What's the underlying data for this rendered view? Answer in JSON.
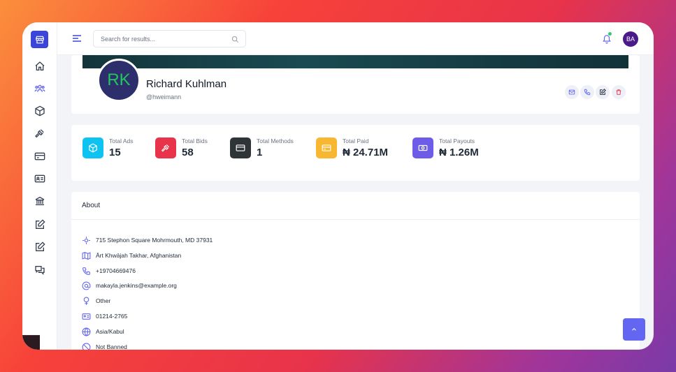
{
  "header": {
    "search_placeholder": "Search for results...",
    "user_initials": "BA"
  },
  "sidebar": {
    "items": [
      {
        "icon": "home-icon"
      },
      {
        "icon": "users-icon"
      },
      {
        "icon": "cube-icon"
      },
      {
        "icon": "gavel-icon"
      },
      {
        "icon": "credit-card-icon"
      },
      {
        "icon": "id-card-icon"
      },
      {
        "icon": "bank-icon"
      },
      {
        "icon": "edit-icon"
      },
      {
        "icon": "edit-icon"
      },
      {
        "icon": "chat-icon"
      }
    ]
  },
  "profile": {
    "initials": "RK",
    "name": "Richard Kuhlman",
    "username": "@hweimann"
  },
  "stats": [
    {
      "label": "Total Ads",
      "value": "15",
      "color": "#0ec3f2",
      "icon": "cube-icon"
    },
    {
      "label": "Total Bids",
      "value": "58",
      "color": "#e8334a",
      "icon": "gavel-icon"
    },
    {
      "label": "Total Methods",
      "value": "1",
      "color": "#2f3437",
      "icon": "credit-card-icon"
    },
    {
      "label": "Total Paid",
      "value": "₦ 24.71M",
      "color": "#f7b731",
      "icon": "credit-card-icon"
    },
    {
      "label": "Total Payouts",
      "value": "₦ 1.26M",
      "color": "#6c5ce7",
      "icon": "money-icon"
    }
  ],
  "about": {
    "title": "About",
    "items": [
      {
        "icon": "location-icon",
        "text": "715 Stephon Square Mohrmouth, MD 37931"
      },
      {
        "icon": "map-icon",
        "text": "Ārt Khwājah Takhar, Afghanistan"
      },
      {
        "icon": "phone-icon",
        "text": "+19704669476"
      },
      {
        "icon": "at-icon",
        "text": "makayla.jenkins@example.org"
      },
      {
        "icon": "gender-icon",
        "text": "Other"
      },
      {
        "icon": "id-card-icon",
        "text": "01214-2765"
      },
      {
        "icon": "globe-icon",
        "text": "Asia/Kabul"
      },
      {
        "icon": "ban-icon",
        "text": "Not Banned"
      }
    ]
  },
  "colors": {
    "accent": "#3b46d9",
    "icon_purple": "#6366f1",
    "status_online": "#2ecc71"
  }
}
